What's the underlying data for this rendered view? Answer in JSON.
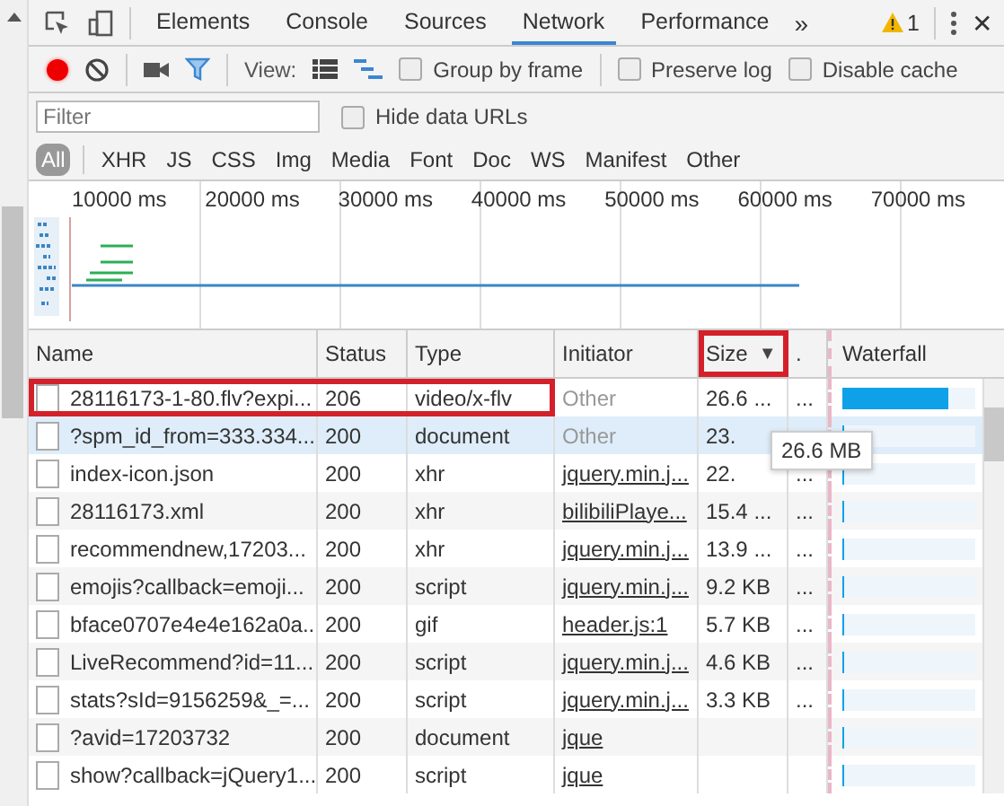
{
  "tabs": [
    {
      "label": "Elements",
      "selected": false
    },
    {
      "label": "Console",
      "selected": false
    },
    {
      "label": "Sources",
      "selected": false
    },
    {
      "label": "Network",
      "selected": true
    },
    {
      "label": "Performance",
      "selected": false
    }
  ],
  "more_tabs": "»",
  "warnings": "1",
  "close": "✕",
  "toolbar": {
    "recording": true,
    "view_label": "View:",
    "options": [
      {
        "label": "Group by frame",
        "checked": false
      },
      {
        "label": "Preserve log",
        "checked": false
      },
      {
        "label": "Disable cache",
        "checked": false
      }
    ]
  },
  "filter": {
    "placeholder": "Filter",
    "hide_data_urls": {
      "label": "Hide data URLs",
      "checked": false
    }
  },
  "types": [
    {
      "label": "All",
      "selected": true
    },
    {
      "label": "XHR",
      "selected": false
    },
    {
      "label": "JS",
      "selected": false
    },
    {
      "label": "CSS",
      "selected": false
    },
    {
      "label": "Img",
      "selected": false
    },
    {
      "label": "Media",
      "selected": false
    },
    {
      "label": "Font",
      "selected": false
    },
    {
      "label": "Doc",
      "selected": false
    },
    {
      "label": "WS",
      "selected": false
    },
    {
      "label": "Manifest",
      "selected": false
    },
    {
      "label": "Other",
      "selected": false
    }
  ],
  "overview_ticks": [
    "10000 ms",
    "20000 ms",
    "30000 ms",
    "40000 ms",
    "50000 ms",
    "60000 ms",
    "70000 ms"
  ],
  "columns": [
    {
      "label": "Name",
      "highlighted": false
    },
    {
      "label": "Status",
      "highlighted": false
    },
    {
      "label": "Type",
      "highlighted": false
    },
    {
      "label": "Initiator",
      "highlighted": false
    },
    {
      "label": "Size",
      "highlighted": true,
      "sort": "▼"
    },
    {
      "label": ".",
      "highlighted": false
    },
    {
      "label": "Waterfall",
      "highlighted": false
    }
  ],
  "rows": [
    {
      "name": "28116173-1-80.flv?expi...",
      "status": "206",
      "type": "video/x-flv",
      "initiator": "Other",
      "link": false,
      "size": "26.6 ...",
      "time": "...",
      "selected": false,
      "highlighted": true,
      "level": 0.8
    },
    {
      "name": "?spm_id_from=333.334...",
      "status": "200",
      "type": "document",
      "initiator": "Other",
      "link": false,
      "size": "23.",
      "selected": true,
      "highlighted": false,
      "level": 0.02
    },
    {
      "name": "index-icon.json",
      "status": "200",
      "type": "xhr",
      "initiator": "jquery.min.j...",
      "link": true,
      "size": "22.",
      "time": "...",
      "selected": false,
      "highlighted": false,
      "level": 0.02
    },
    {
      "name": "28116173.xml",
      "status": "200",
      "type": "xhr",
      "initiator": "bilibiliPlaye...",
      "link": true,
      "size": "15.4 ...",
      "time": "...",
      "selected": false,
      "highlighted": false,
      "level": 0.02
    },
    {
      "name": "recommendnew,17203...",
      "status": "200",
      "type": "xhr",
      "initiator": "jquery.min.j...",
      "link": true,
      "size": "13.9 ...",
      "time": "...",
      "selected": false,
      "highlighted": false,
      "level": 0.02
    },
    {
      "name": "emojis?callback=emoji...",
      "status": "200",
      "type": "script",
      "initiator": "jquery.min.j...",
      "link": true,
      "size": "9.2 KB",
      "time": "...",
      "selected": false,
      "highlighted": false,
      "level": 0.02
    },
    {
      "name": "bface0707e4e4e162a0a...",
      "status": "200",
      "type": "gif",
      "initiator": "header.js:1",
      "link": true,
      "size": "5.7 KB",
      "time": "...",
      "selected": false,
      "highlighted": false,
      "level": 0.02
    },
    {
      "name": "LiveRecommend?id=11...",
      "status": "200",
      "type": "script",
      "initiator": "jquery.min.j...",
      "link": true,
      "size": "4.6 KB",
      "time": "...",
      "selected": false,
      "highlighted": false,
      "level": 0.02
    },
    {
      "name": "stats?sId=9156259&_=...",
      "status": "200",
      "type": "script",
      "initiator": "jquery.min.j...",
      "link": true,
      "size": "3.3 KB",
      "time": "...",
      "selected": false,
      "highlighted": false,
      "level": 0.02
    },
    {
      "name": "?avid=17203732",
      "status": "200",
      "type": "document",
      "initiator": "jque",
      "link": true,
      "selected": false,
      "highlighted": false,
      "level": 0.02
    },
    {
      "name": "show?callback=jQuery1...",
      "status": "200",
      "type": "script",
      "initiator": "jque",
      "link": true,
      "selected": false,
      "highlighted": false,
      "level": 0.02
    }
  ],
  "tooltip": "26.6 MB"
}
